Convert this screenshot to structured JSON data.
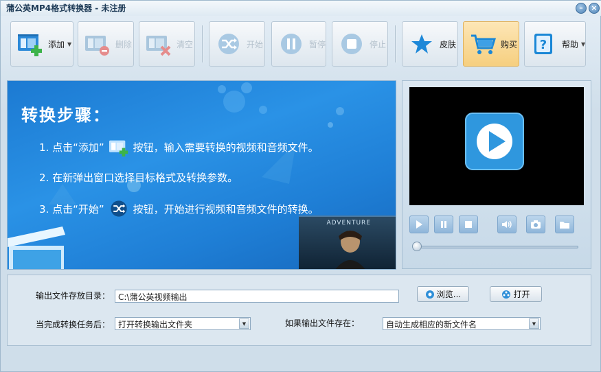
{
  "window": {
    "title": "蒲公英MP4格式转换器 - 未注册"
  },
  "toolbar": {
    "add": "添加",
    "delete": "删除",
    "clear": "清空",
    "start": "开始",
    "pause": "暂停",
    "stop": "停止",
    "skin": "皮肤",
    "buy": "购买",
    "help": "帮助"
  },
  "banner": {
    "title": "转换步骤：",
    "step1_a": "1. 点击“添加”",
    "step1_b": "按钮，输入需要转换的视频和音频文件。",
    "step2": "2. 在新弹出窗口选择目标格式及转换参数。",
    "step3_a": "3. 点击“开始”",
    "step3_b": "按钮，开始进行视频和音频文件的转换。",
    "poster_text": "ADVENTURE"
  },
  "settings": {
    "output_dir_label": "输出文件存放目录：",
    "output_dir_value": "C:\\蒲公英视频输出",
    "browse": "浏览...",
    "open": "打开",
    "after_label": "当完成转换任务后：",
    "after_value": "打开转换输出文件夹",
    "exists_label": "如果输出文件存在：",
    "exists_value": "自动生成相应的新文件名"
  },
  "colors": {
    "accent": "#2a92e6",
    "buy_highlight": "#f6cf7f"
  }
}
